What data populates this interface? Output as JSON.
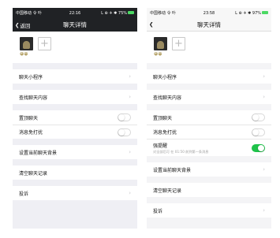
{
  "left_screen": {
    "status": {
      "carrier": "中国移动 令 卟",
      "time": "22:16",
      "right": "L ⊕ ✈ ✱ 75%"
    },
    "nav": {
      "back": "返回",
      "title": "聊天详情"
    },
    "member": {
      "name": "😀😀"
    },
    "rows": {
      "mini_program": "聊天小程序",
      "find_content": "查找聊天内容",
      "pin_chat": "置顶聊天",
      "mute": "消息免打扰",
      "set_background": "设置当前聊天背景",
      "clear_history": "清空聊天记录",
      "report": "投诉"
    },
    "toggles": {
      "pin_chat": false,
      "mute": false
    }
  },
  "right_screen": {
    "status": {
      "carrier": "中国移动 令 卟",
      "time": "23:58",
      "right": "L ⊕ ✈ ✱ 97%"
    },
    "nav": {
      "title": "聊天详情"
    },
    "member": {
      "name": "😀😀"
    },
    "rows": {
      "mini_program": "聊天小程序",
      "find_content": "查找聊天内容",
      "pin_chat": "置顶聊天",
      "mute": "消息免打扰",
      "strong_remind": "强提醒",
      "strong_remind_sub": "对全部后可 在 01:50 前到第一条消息",
      "set_background": "设置当前聊天背景",
      "clear_history": "清空聊天记录",
      "report": "投诉"
    },
    "toggles": {
      "pin_chat": false,
      "mute": false,
      "strong_remind": true
    }
  },
  "colors": {
    "toggle_on": "#1fc34a",
    "dark_header": "#202225"
  }
}
